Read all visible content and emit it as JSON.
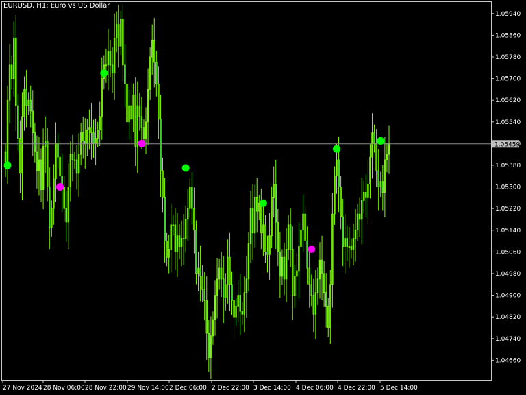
{
  "header": {
    "title": "EURUSD, H1:  Euro vs US Dollar"
  },
  "colors": {
    "background": "#000000",
    "frame": "#c8c8c8",
    "candle": "#2ecc2e",
    "candle_edge": "#7CFC00",
    "dot_up": "#00ff00",
    "dot_down": "#ff00ff",
    "price_line": "#8c8c8c",
    "price_box": "#c0c0c0"
  },
  "chart_data": {
    "type": "candlestick",
    "symbol": "EURUSD",
    "timeframe": "H1",
    "title": "EURUSD, H1:  Euro vs US Dollar",
    "current_price": "1.05459",
    "ylim": [
      1.0459,
      1.0598
    ],
    "yticks": [
      "1.05940",
      "1.05860",
      "1.05780",
      "1.05700",
      "1.05620",
      "1.05540",
      "1.05460",
      "1.05380",
      "1.05300",
      "1.05220",
      "1.05140",
      "1.05060",
      "1.04980",
      "1.04900",
      "1.04820",
      "1.04740",
      "1.04660"
    ],
    "xticks": [
      "27 Nov 2024",
      "28 Nov 06:00",
      "28 Nov 22:00",
      "29 Nov 14:00",
      "2 Dec 06:00",
      "2 Dec 22:00",
      "3 Dec 14:00",
      "4 Dec 06:00",
      "4 Dec 22:00",
      "5 Dec 14:00"
    ],
    "closes": [
      1.0537,
      1.0562,
      1.0575,
      1.057,
      1.0585,
      1.056,
      1.0548,
      1.0535,
      1.0556,
      1.0566,
      1.056,
      1.0562,
      1.0558,
      1.055,
      1.0543,
      1.0536,
      1.054,
      1.0529,
      1.0545,
      1.0547,
      1.053,
      1.0515,
      1.0522,
      1.0533,
      1.0546,
      1.0541,
      1.0534,
      1.053,
      1.0522,
      1.0517,
      1.053,
      1.0542,
      1.054,
      1.054,
      1.0535,
      1.0542,
      1.055,
      1.0547,
      1.0546,
      1.0551,
      1.0552,
      1.055,
      1.0546,
      1.0548,
      1.0551,
      1.0556,
      1.057,
      1.0575,
      1.0575,
      1.058,
      1.0575,
      1.0572,
      1.0585,
      1.059,
      1.0582,
      1.0592,
      1.0575,
      1.0568,
      1.0554,
      1.056,
      1.0555,
      1.0564,
      1.0545,
      1.056,
      1.0556,
      1.0552,
      1.0548,
      1.0554,
      1.0566,
      1.0578,
      1.0584,
      1.0576,
      1.0568,
      1.0555,
      1.0536,
      1.0526,
      1.051,
      1.0504,
      1.0507,
      1.0516,
      1.0516,
      1.0506,
      1.0512,
      1.0508,
      1.0511,
      1.0511,
      1.0518,
      1.0522,
      1.053,
      1.0522,
      1.0514,
      1.0498,
      1.05,
      1.0497,
      1.0492,
      1.0488,
      1.0476,
      1.0467,
      1.0475,
      1.0481,
      1.049,
      1.0496,
      1.05,
      1.0496,
      1.0489,
      1.0494,
      1.0504,
      1.0494,
      1.0488,
      1.0482,
      1.0486,
      1.049,
      1.0484,
      1.0483,
      1.0491,
      1.0496,
      1.0509,
      1.0522,
      1.0513,
      1.0526,
      1.0521,
      1.0524,
      1.0513,
      1.0516,
      1.0506,
      1.0505,
      1.0512,
      1.0526,
      1.0531,
      1.0517,
      1.0506,
      1.0497,
      1.0504,
      1.0496,
      1.0507,
      1.0516,
      1.0507,
      1.049,
      1.0497,
      1.0499,
      1.0508,
      1.0514,
      1.052,
      1.051,
      1.05,
      1.0494,
      1.049,
      1.0483,
      1.0491,
      1.0496,
      1.0503,
      1.0498,
      1.0491,
      1.0486,
      1.0478,
      1.0494,
      1.052,
      1.0534,
      1.054,
      1.053,
      1.0519,
      1.0508,
      1.0511,
      1.0508,
      1.0508,
      1.0507,
      1.0511,
      1.0514,
      1.052,
      1.0518,
      1.0525,
      1.0528,
      1.0526,
      1.0531,
      1.0541,
      1.055,
      1.0546,
      1.0536,
      1.053,
      1.0532,
      1.0528,
      1.054,
      1.0542,
      1.0546
    ],
    "signals": [
      {
        "index": 1,
        "price": 1.0538,
        "signal": "up"
      },
      {
        "index": 26,
        "price": 1.053,
        "signal": "down"
      },
      {
        "index": 47,
        "price": 1.0572,
        "signal": "up"
      },
      {
        "index": 65,
        "price": 1.0546,
        "signal": "down"
      },
      {
        "index": 86,
        "price": 1.0537,
        "signal": "up"
      },
      {
        "index": 123,
        "price": 1.0524,
        "signal": "up"
      },
      {
        "index": 146,
        "price": 1.0507,
        "signal": "down"
      },
      {
        "index": 158,
        "price": 1.0544,
        "signal": "up"
      },
      {
        "index": 179,
        "price": 1.0547,
        "signal": "up"
      }
    ]
  }
}
